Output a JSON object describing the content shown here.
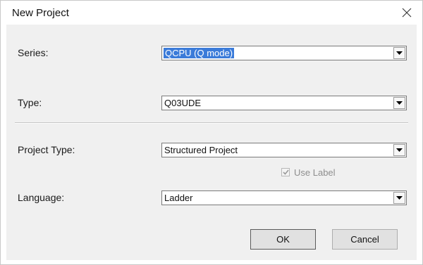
{
  "window": {
    "title": "New Project",
    "close_icon": "close-icon"
  },
  "form": {
    "series": {
      "label": "Series:",
      "value": "QCPU (Q mode)"
    },
    "type": {
      "label": "Type:",
      "value": "Q03UDE"
    },
    "project_type": {
      "label": "Project Type:",
      "value": "Structured Project"
    },
    "use_label": {
      "label": "Use Label",
      "checked": true,
      "enabled": false
    },
    "language": {
      "label": "Language:",
      "value": "Ladder"
    }
  },
  "buttons": {
    "ok": "OK",
    "cancel": "Cancel"
  },
  "colors": {
    "selection": "#3b7bd9",
    "dialog_background": "#f0f0f0"
  }
}
